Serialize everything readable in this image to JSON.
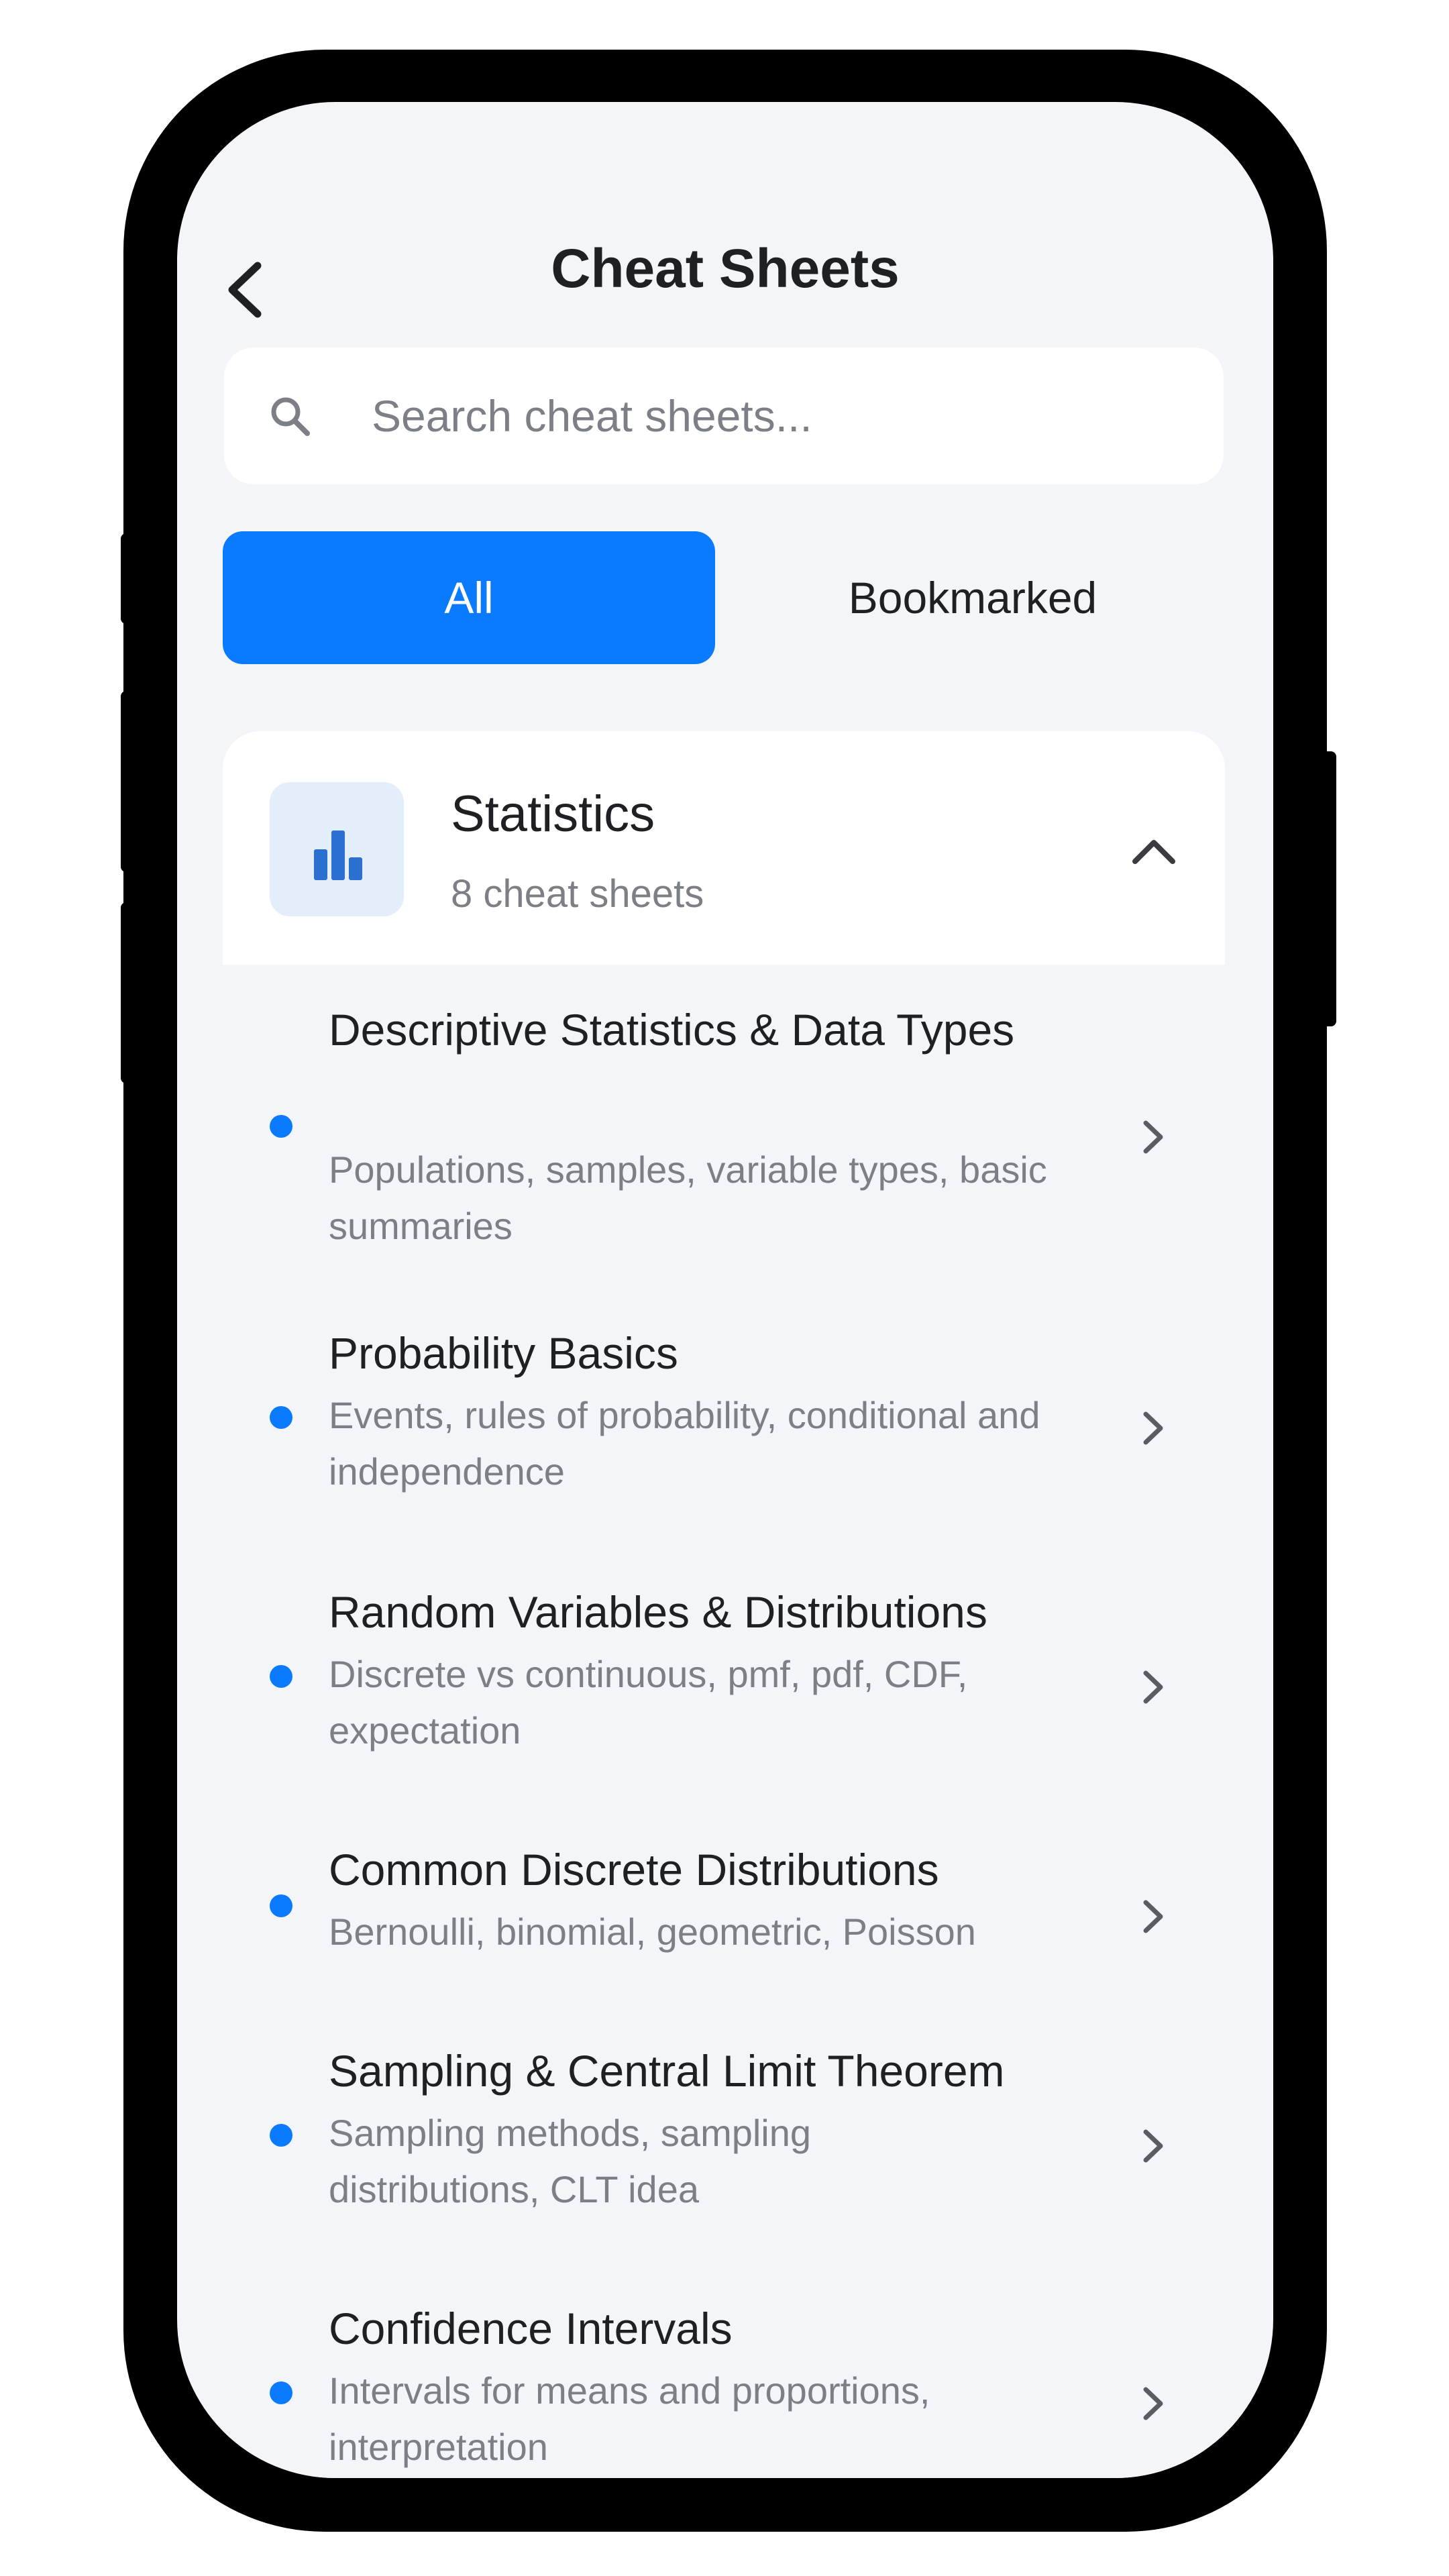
{
  "header": {
    "title": "Cheat Sheets",
    "back_icon": "chevron-left-icon"
  },
  "search": {
    "placeholder": "Search cheat sheets...",
    "value": "",
    "icon": "search-icon"
  },
  "segments": {
    "items": [
      {
        "label": "All",
        "selected": true
      },
      {
        "label": "Bookmarked",
        "selected": false
      }
    ]
  },
  "category": {
    "title": "Statistics",
    "count": "8 cheat sheets",
    "icon": "bar-chart-icon",
    "expanded": true,
    "items": [
      {
        "title": "Descriptive Statistics & Data Types",
        "subtitle": "Populations, samples, variable types, basic summaries"
      },
      {
        "title": "Probability Basics",
        "subtitle": "Events, rules of probability, conditional and independence"
      },
      {
        "title": "Random Variables & Distributions",
        "subtitle": "Discrete vs continuous, pmf, pdf, CDF, expectation"
      },
      {
        "title": "Common Discrete Distributions",
        "subtitle": "Bernoulli, binomial, geometric, Poisson"
      },
      {
        "title": "Sampling & Central Limit Theorem",
        "subtitle": "Sampling methods, sampling distributions, CLT idea"
      },
      {
        "title": "Confidence Intervals",
        "subtitle": "Intervals for means and proportions, interpretation"
      }
    ]
  },
  "colors": {
    "accent": "#0a7bff",
    "background": "#f4f5f8",
    "text": "#1f2024",
    "muted": "#7d7f87"
  }
}
